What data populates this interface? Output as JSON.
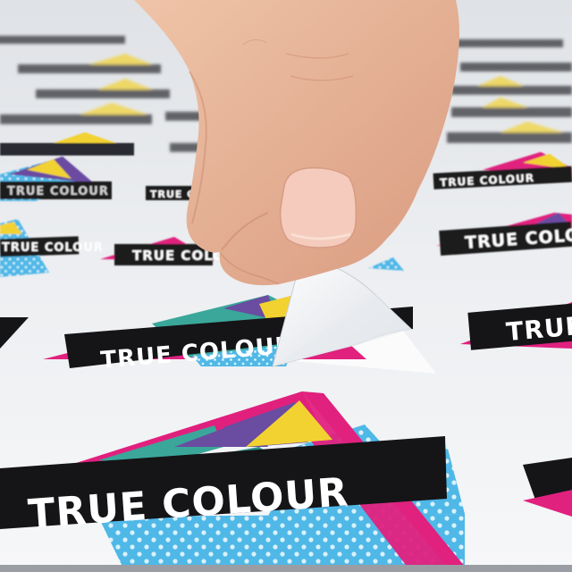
{
  "image": {
    "sticker_label": "TRUE COLOUR",
    "colors": {
      "sheet": "#f2f3f5",
      "banner": "#151417",
      "label_text": "#ffffff",
      "magenta": "#e0217e",
      "cyan": "#4fb8e7",
      "yellow": "#f2d230",
      "purple": "#6a4ca1",
      "teal": "#3aa79a",
      "skin": "#e9b699",
      "nail": "#f4cbbc"
    }
  }
}
